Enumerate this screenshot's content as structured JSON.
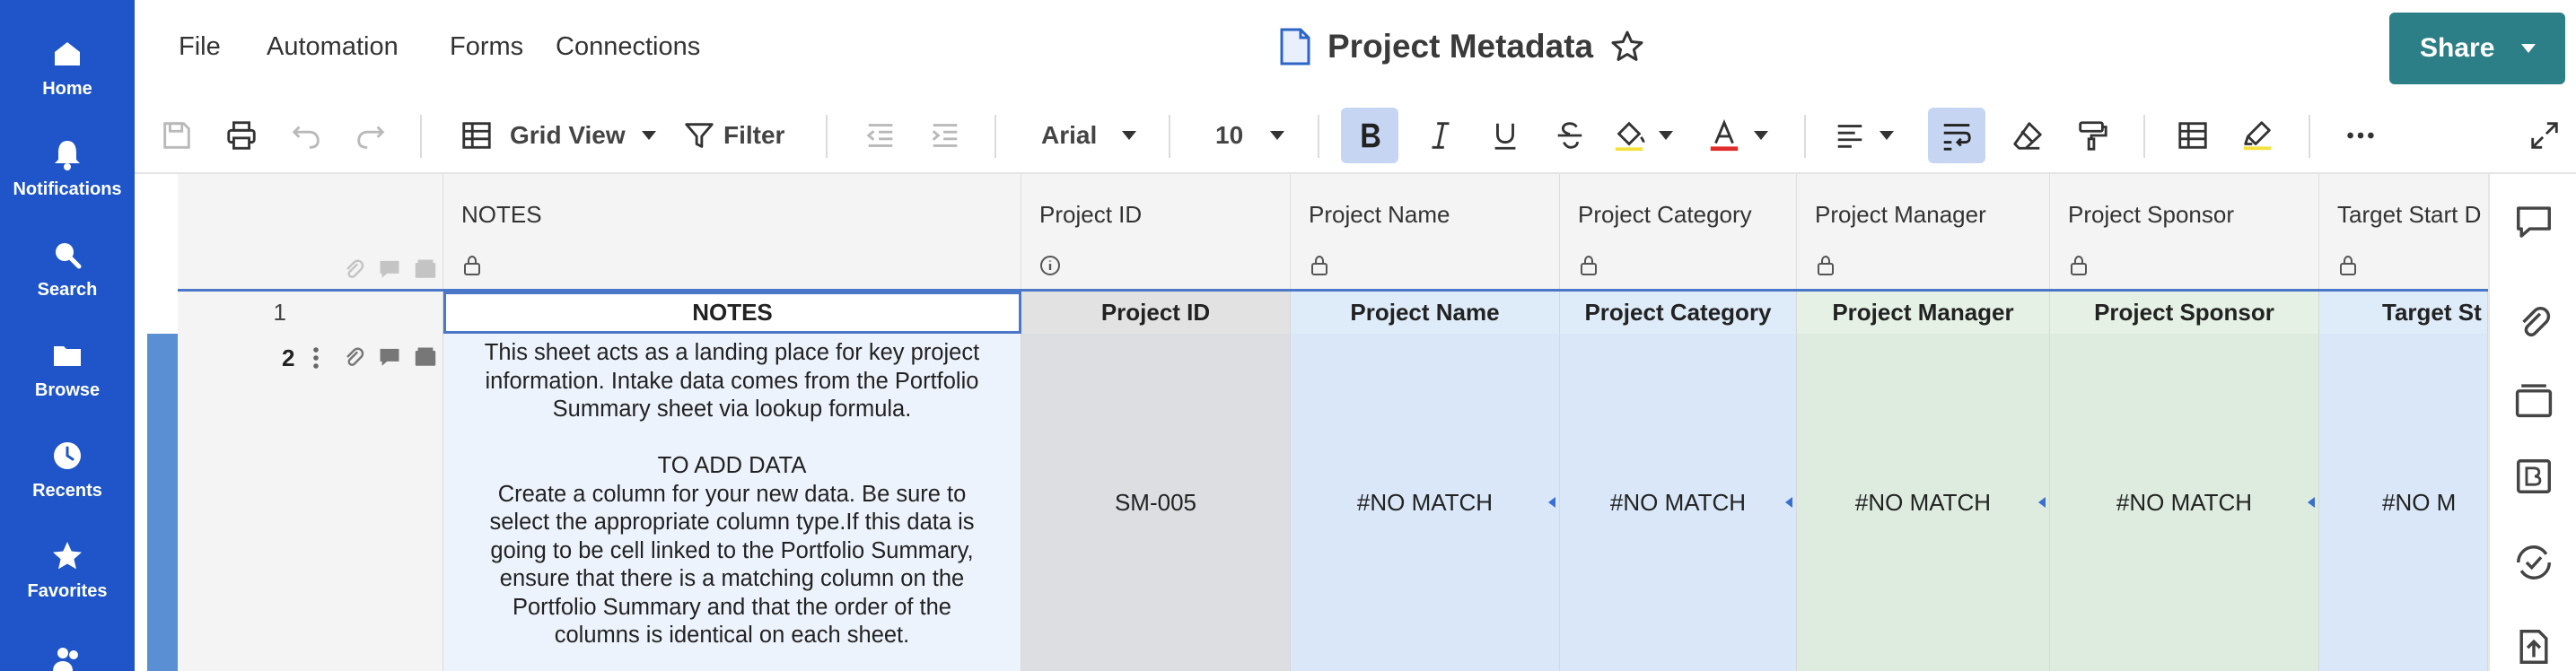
{
  "nav": {
    "items": [
      {
        "label": "Home",
        "icon": "home-icon"
      },
      {
        "label": "Notifications",
        "icon": "bell-icon"
      },
      {
        "label": "Search",
        "icon": "search-icon"
      },
      {
        "label": "Browse",
        "icon": "folder-icon"
      },
      {
        "label": "Recents",
        "icon": "clock-icon"
      },
      {
        "label": "Favorites",
        "icon": "star-icon"
      }
    ]
  },
  "menu": {
    "file": "File",
    "automation": "Automation",
    "forms": "Forms",
    "connections": "Connections"
  },
  "document": {
    "title": "Project Metadata"
  },
  "share": {
    "label": "Share"
  },
  "toolbar": {
    "view_label": "Grid View",
    "filter_label": "Filter",
    "font_family": "Arial",
    "font_size": "10"
  },
  "columns": [
    {
      "name": "NOTES",
      "header_icon": "lock-icon"
    },
    {
      "name": "Project ID",
      "header_icon": "info-icon"
    },
    {
      "name": "Project Name",
      "header_icon": "lock-icon"
    },
    {
      "name": "Project Category",
      "header_icon": "lock-icon"
    },
    {
      "name": "Project Manager",
      "header_icon": "lock-icon"
    },
    {
      "name": "Project Sponsor",
      "header_icon": "lock-icon"
    },
    {
      "name": "Target Start D",
      "header_icon": "lock-icon"
    }
  ],
  "rows": [
    {
      "number": "1",
      "cells": [
        "NOTES",
        "Project ID",
        "Project Name",
        "Project Category",
        "Project Manager",
        "Project Sponsor",
        "Target St"
      ]
    },
    {
      "number": "2",
      "notes_lines": [
        "This sheet acts as a landing place for key project",
        "information. Intake data comes from the Portfolio",
        "Summary sheet via lookup formula.",
        "",
        "TO ADD DATA",
        "Create a column for your new data. Be sure to",
        "select the appropriate column type.If this data is",
        "going to be cell linked to the Portfolio Summary,",
        "ensure that there is a matching column on the",
        "Portfolio Summary and that the order of the",
        "columns is identical on each sheet."
      ],
      "cells": [
        "SM-005",
        "#NO MATCH",
        "#NO MATCH",
        "#NO MATCH",
        "#NO MATCH",
        "#NO M"
      ]
    }
  ],
  "colors": {
    "nav_bg": "#1f55c8",
    "share_bg": "#2c7f86",
    "accent": "#4a77c7"
  }
}
